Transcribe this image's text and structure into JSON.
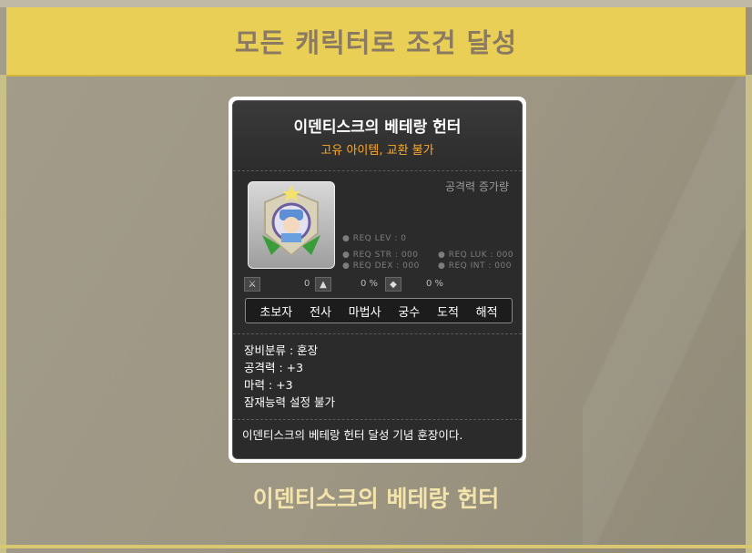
{
  "banner": {
    "text": "모든 캐릭터로 조건 달성"
  },
  "item": {
    "name": "이덴티스크의 베테랑 헌터",
    "tag": "고유 아이템, 교환 불가",
    "attack_label": "공격력 증가량",
    "req": {
      "lev": "● REQ LEV :    0",
      "str": "● REQ STR : 000",
      "luk": "● REQ LUK : 000",
      "dex": "● REQ DEX : 000",
      "int": "● REQ INT : 000"
    },
    "mini": [
      {
        "icon": "sword-crossed-icon",
        "value": "0"
      },
      {
        "icon": "helmet-icon",
        "value": "0 %"
      },
      {
        "icon": "shield-icon",
        "value": "0 %"
      }
    ],
    "jobs": [
      "초보자",
      "전사",
      "마법사",
      "궁수",
      "도적",
      "해적"
    ],
    "stats": [
      "장비분류 : 훈장",
      "공격력 : +3",
      "마력 : +3",
      "잠재능력 설정 불가"
    ],
    "description": "이덴티스크의 베테랑 헌터 달성 기념 훈장이다.",
    "colors": {
      "title": "#ffffff",
      "tag": "#ffaa22",
      "banner": "#e9cf55"
    }
  },
  "footer": {
    "name": "이덴티스크의 베테랑 헌터"
  }
}
